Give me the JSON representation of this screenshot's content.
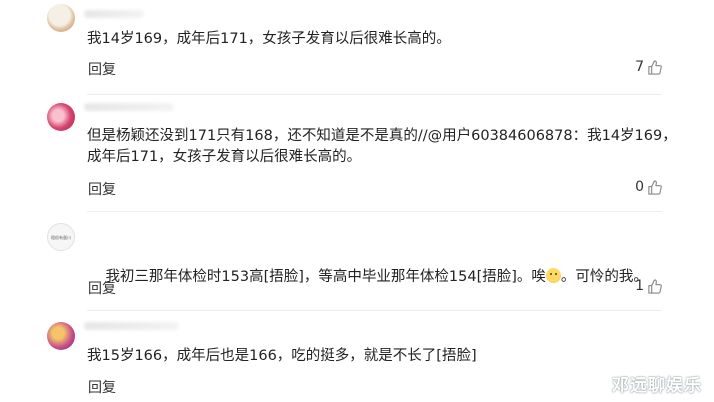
{
  "comments": [
    {
      "text": "我14岁169，成年后171，女孩子发育以后很难长高的。",
      "reply_label": "回复",
      "likes": "7",
      "avatar_colors": [
        "#f3ede4",
        "#c9a27a"
      ]
    },
    {
      "text": "但是杨颖还没到171只有168，还不知道是不是真的//@用户60384606878：我14岁169，成年后171，女孩子发育以后很难长高的。",
      "reply_label": "回复",
      "likes": "0",
      "avatar_colors": [
        "#d23a6a",
        "#f7b3c5"
      ]
    },
    {
      "text_before": "我初三那年体检时153高[捂脸]，等高中毕业那年体检154[捂脸]。唉",
      "text_after": "。可怜的我。",
      "reply_label": "回复",
      "likes": "1",
      "avatar_colors": [
        "#f7f7f7",
        "#cfcfcf"
      ],
      "avatar_text": "粗俗有蛋川"
    },
    {
      "text": "我15岁166，成年后也是166，吃的挺多，就是不长了[捂脸]",
      "reply_label": "回复",
      "likes": "",
      "avatar_colors": [
        "#c64b8c",
        "#f0b25d"
      ]
    }
  ],
  "watermark": "邓远聊娱乐",
  "icon": "thumb-up-icon"
}
